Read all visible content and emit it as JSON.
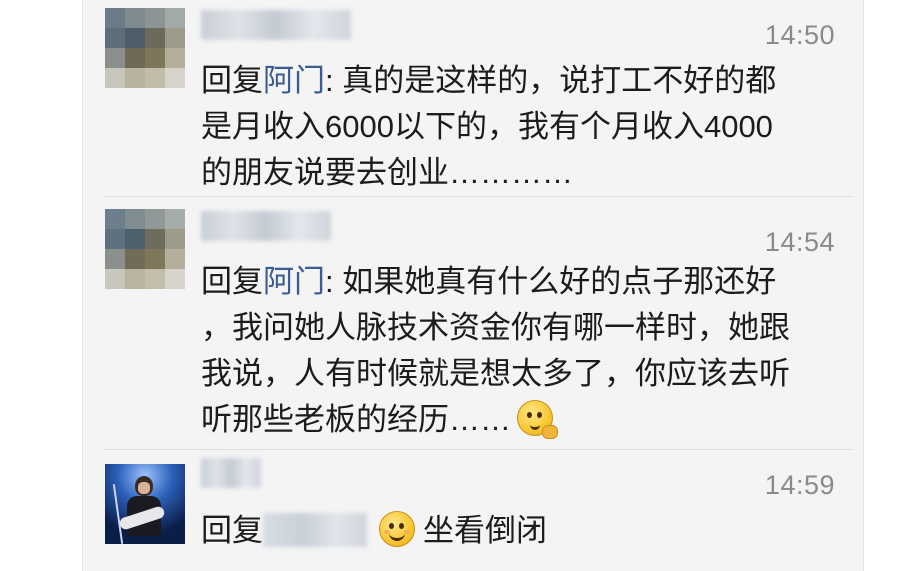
{
  "comments": [
    {
      "time": "14:50",
      "reply_prefix": "回复",
      "reply_to": "阿门",
      "lines": [
        ": 真的是这样的，说打工不好的都",
        "是月收入6000以下的，我有个月收入4000",
        "的朋友说要去创业…………"
      ]
    },
    {
      "time": "14:54",
      "reply_prefix": "回复",
      "reply_to": "阿门",
      "lines": [
        ": 如果她真有什么好的点子那还好",
        "，我问她人脉技术资金你有哪一样时，她跟",
        "我说，人有时候就是想太多了，你应该去听",
        "听那些老板的经历……"
      ],
      "emoji": "thinking-emoji"
    },
    {
      "time": "14:59",
      "reply_prefix": "回复",
      "text": "坐看倒闭",
      "emoji": "smile-emoji"
    }
  ],
  "colors": {
    "link": "#3b5b92",
    "time": "#8a8a8a",
    "background": "#f4f4f5"
  }
}
